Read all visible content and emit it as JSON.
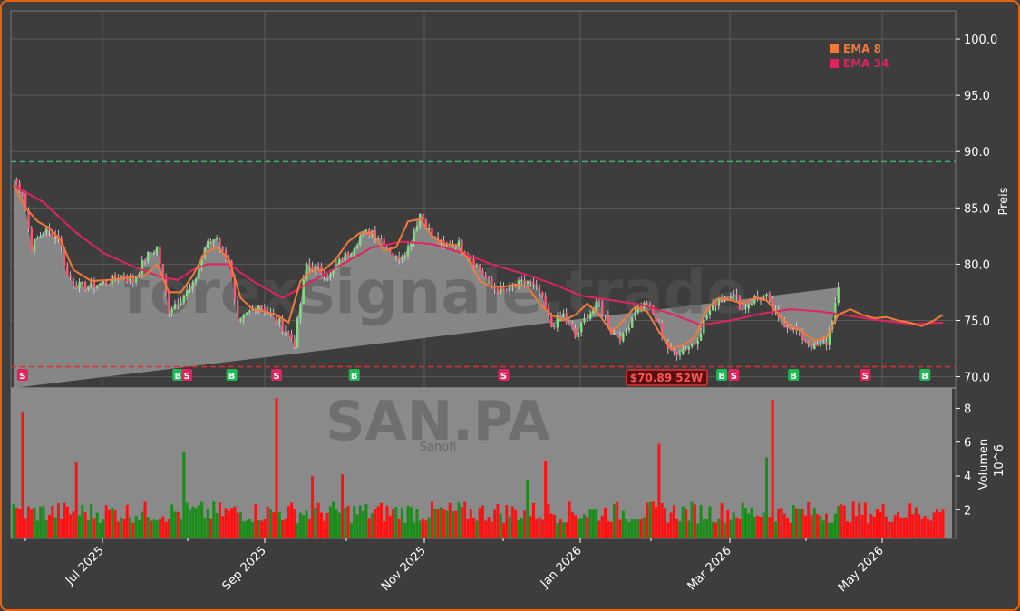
{
  "colors": {
    "background": "#3d3d3d",
    "border": "#e8620c",
    "area": "#8a8a8a",
    "ema8": "#f07a3a",
    "ema34": "#e0245e",
    "buy": "#1db954",
    "sell": "#e0245e",
    "vol_up": "#1a8c1a",
    "vol_down": "#ff1111",
    "resistance": "#3cb371",
    "support": "#e03030"
  },
  "watermark": {
    "main": "forexsignale.trade",
    "ticker": "SAN.PA",
    "company": "Sanofi"
  },
  "chart_data": [
    {
      "type": "line",
      "role": "price",
      "ylabel": "Preis",
      "ylim": [
        69,
        102.5
      ],
      "yticks": [
        "70.0",
        "75.0",
        "80.0",
        "85.0",
        "90.0",
        "95.0",
        "100.0"
      ],
      "xticks": [
        "Jul 2025",
        "Sep 2025",
        "Nov 2025",
        "Jan 2026",
        "Mar 2026",
        "May 2026"
      ],
      "legend": {
        "position": "top-right",
        "entries": [
          "EMA 8",
          "EMA 34"
        ]
      },
      "resistance_level": 89.1,
      "support_level": 70.89,
      "support_label": "$70.89 52W",
      "close_anchor": {
        "day": [
          0,
          3,
          6,
          10,
          15,
          18,
          22,
          28,
          32,
          36,
          40,
          44,
          48,
          52,
          56,
          60,
          64,
          68,
          70,
          72,
          75,
          78,
          82,
          86,
          90,
          94,
          98,
          102,
          106,
          110,
          112,
          116,
          120,
          124,
          128,
          132,
          136,
          140,
          144,
          148,
          152,
          156,
          160,
          164,
          168,
          172,
          176,
          180,
          184,
          188,
          192,
          196,
          200,
          204,
          208,
          212,
          216,
          220,
          224,
          228,
          232,
          236,
          240,
          244,
          248,
          252,
          256,
          260,
          264,
          268,
          272,
          276,
          280,
          284,
          288,
          292,
          296,
          300,
          304,
          308,
          311
        ],
        "price": [
          87.5,
          86.5,
          81.5,
          83.0,
          82.5,
          79.0,
          78.0,
          78.2,
          78.5,
          79.0,
          78.5,
          80.5,
          81.5,
          76.0,
          77.0,
          78.0,
          81.5,
          82.5,
          81.0,
          80.5,
          74.5,
          75.5,
          76.5,
          75.5,
          74.5,
          73.0,
          80.0,
          79.5,
          79.0,
          80.5,
          81.0,
          82.5,
          83.0,
          82.0,
          80.5,
          81.5,
          84.5,
          82.5,
          81.5,
          82.0,
          81.0,
          79.5,
          78.0,
          77.5,
          78.0,
          78.5,
          77.5,
          74.5,
          75.5,
          73.5,
          75.5,
          76.5,
          74.0,
          73.5,
          76.0,
          76.5,
          74.5,
          72.0,
          72.5,
          73.0,
          75.5,
          77.0,
          77.5,
          76.0,
          77.0,
          77.0,
          75.0,
          74.5,
          73.5,
          72.5,
          73.0,
          77.5
        ]
      },
      "ema8_anchor": {
        "day": [
          0,
          4,
          8,
          12,
          16,
          20,
          26,
          32,
          38,
          44,
          48,
          52,
          56,
          60,
          64,
          68,
          72,
          76,
          80,
          84,
          88,
          92,
          96,
          100,
          104,
          108,
          112,
          116,
          120,
          124,
          128,
          132,
          136,
          140,
          144,
          148,
          152,
          156,
          160,
          164,
          168,
          172,
          176,
          180,
          184,
          188,
          192,
          196,
          200,
          204,
          208,
          212,
          216,
          220,
          224,
          228,
          232,
          236,
          240,
          244,
          248,
          252,
          256,
          260,
          264,
          268,
          272,
          276,
          280,
          284,
          288,
          292,
          296,
          300,
          304,
          308,
          311
        ],
        "price": [
          87.0,
          85.0,
          83.8,
          83.2,
          82.0,
          79.5,
          78.5,
          78.6,
          78.8,
          79.0,
          80.0,
          77.5,
          77.5,
          79.0,
          81.0,
          81.5,
          80.5,
          77.0,
          76.0,
          75.8,
          75.5,
          74.8,
          78.5,
          79.5,
          79.5,
          80.5,
          82.0,
          82.8,
          82.8,
          81.2,
          81.5,
          83.8,
          84.0,
          82.5,
          81.8,
          81.7,
          80.5,
          78.5,
          78.0,
          78.0,
          78.2,
          78.0,
          76.5,
          75.5,
          75.0,
          75.5,
          76.5,
          75.5,
          74.0,
          75.0,
          76.2,
          75.8,
          74.0,
          72.5,
          72.8,
          73.5,
          76.0,
          77.0,
          76.8,
          76.5,
          77.0,
          76.8,
          75.5,
          74.5,
          74.0,
          73.2,
          73.5,
          75.5,
          76.0,
          75.5,
          75.2,
          75.3,
          75.0,
          74.8,
          74.5,
          75.0,
          75.5
        ]
      },
      "ema34_anchor": {
        "day": [
          0,
          10,
          20,
          30,
          40,
          50,
          55,
          60,
          65,
          72,
          80,
          90,
          100,
          110,
          120,
          130,
          140,
          150,
          160,
          170,
          180,
          190,
          200,
          210,
          220,
          230,
          240,
          250,
          260,
          270,
          280,
          290,
          300,
          311
        ],
        "price": [
          87.0,
          85.5,
          83.0,
          81.0,
          79.8,
          78.8,
          78.6,
          79.5,
          80.0,
          80.0,
          78.5,
          77.0,
          78.5,
          80.0,
          81.5,
          82.0,
          81.8,
          81.0,
          80.0,
          79.2,
          78.3,
          77.2,
          76.8,
          76.4,
          75.6,
          74.6,
          75.0,
          75.6,
          76.0,
          75.8,
          75.4,
          75.0,
          74.7,
          74.8
        ]
      },
      "signals": [
        {
          "label": "S",
          "day": 3
        },
        {
          "label": "B",
          "day": 55
        },
        {
          "label": "S",
          "day": 58
        },
        {
          "label": "B",
          "day": 73
        },
        {
          "label": "S",
          "day": 88
        },
        {
          "label": "B",
          "day": 114
        },
        {
          "label": "S",
          "day": 164
        },
        {
          "label": "B",
          "day": 237
        },
        {
          "label": "S",
          "day": 241
        },
        {
          "label": "B",
          "day": 261
        },
        {
          "label": "S",
          "day": 285
        },
        {
          "label": "B",
          "day": 305
        }
      ]
    },
    {
      "type": "bar",
      "role": "volume",
      "ylabel": "Volumen",
      "exponent": "10^6",
      "yticks": [
        "2",
        "4",
        "6",
        "8"
      ],
      "ylim": [
        0.3,
        9.2
      ],
      "volume_spikes": [
        {
          "day": 3,
          "value": 7.8
        },
        {
          "day": 21,
          "value": 4.8
        },
        {
          "day": 57,
          "value": 5.4
        },
        {
          "day": 88,
          "value": 8.6
        },
        {
          "day": 100,
          "value": 4.0
        },
        {
          "day": 110,
          "value": 4.1
        },
        {
          "day": 172,
          "value": 3.8
        },
        {
          "day": 178,
          "value": 4.9
        },
        {
          "day": 216,
          "value": 5.9
        },
        {
          "day": 254,
          "value": 8.5
        },
        {
          "day": 252,
          "value": 5.1
        }
      ]
    }
  ]
}
